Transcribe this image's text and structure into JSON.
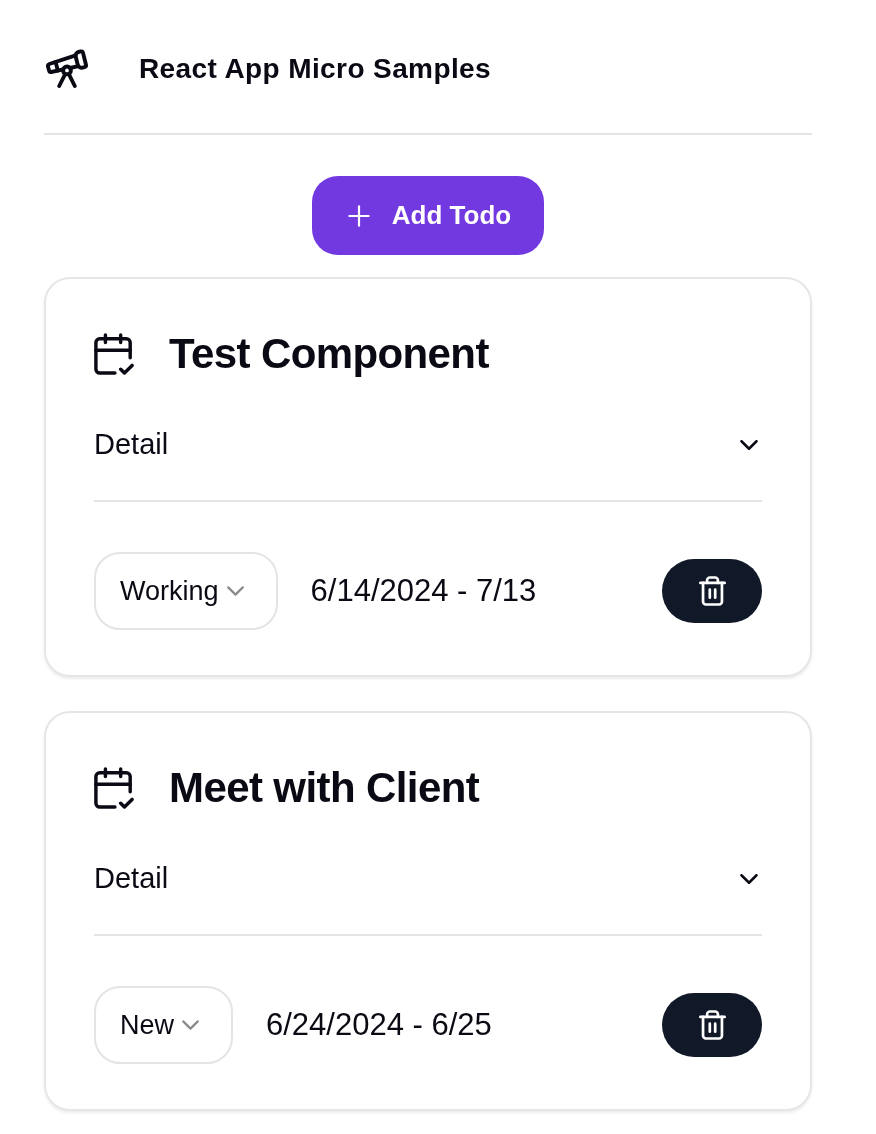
{
  "header": {
    "title": "React App Micro Samples"
  },
  "add_button": {
    "label": "Add Todo"
  },
  "todos": [
    {
      "title": "Test Component",
      "detail": {
        "label": "Detail",
        "expanded": false
      },
      "status": "Working",
      "dates": "6/14/2024 - 7/13"
    },
    {
      "title": "Meet with Client",
      "detail": {
        "label": "Detail",
        "expanded": false
      },
      "status": "New",
      "dates": "6/24/2024 - 6/25"
    }
  ]
}
